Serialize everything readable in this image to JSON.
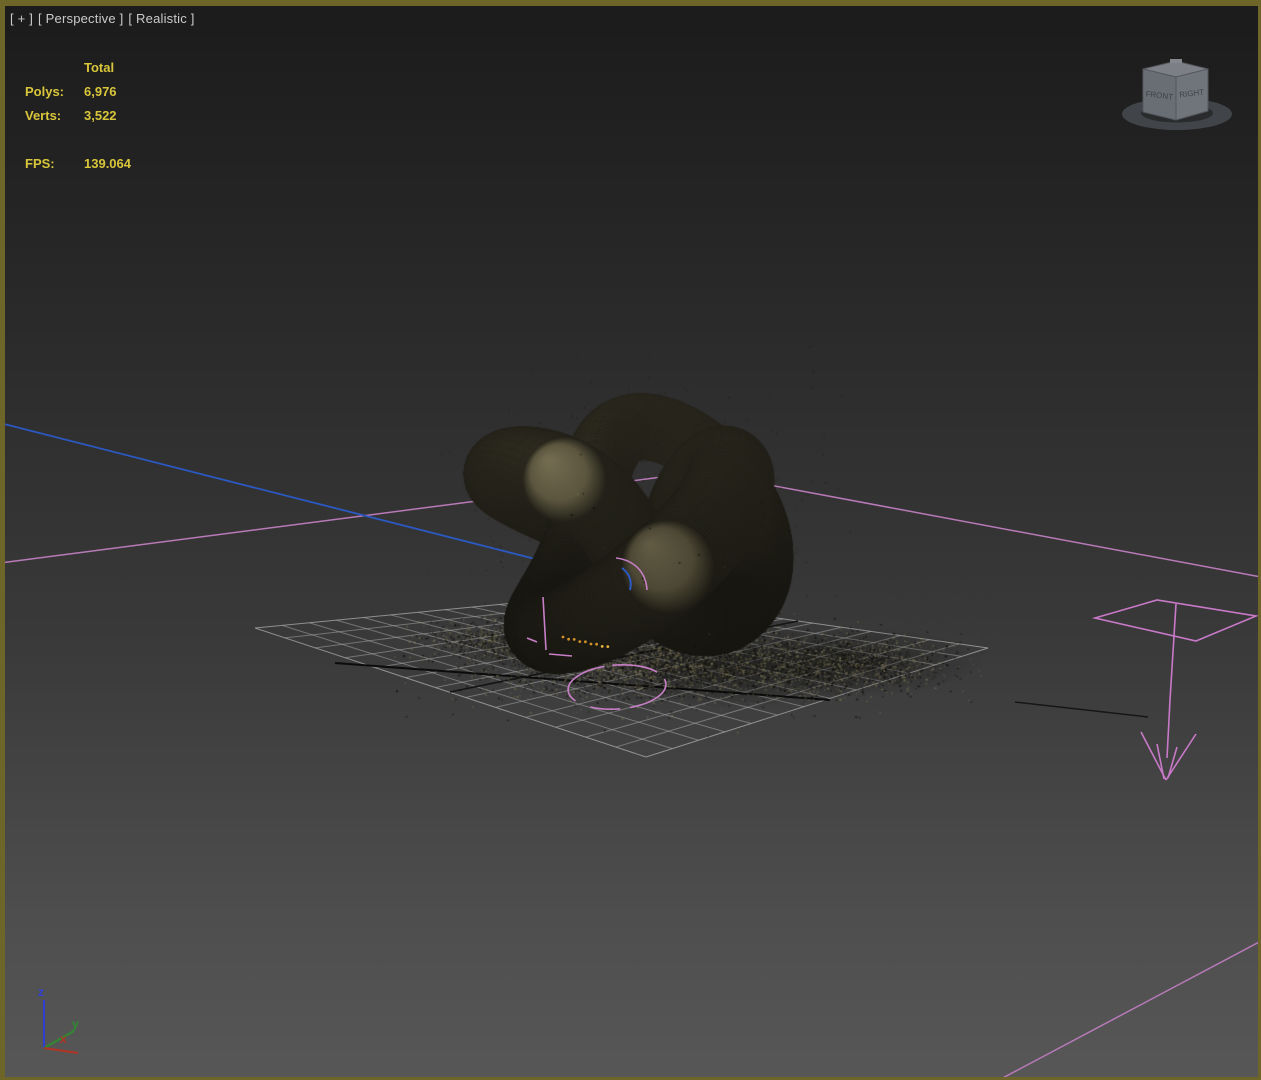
{
  "viewport": {
    "label": {
      "general_menu": "[ + ]",
      "pov": "[ Perspective ]",
      "shading": "[ Realistic ]"
    },
    "border_color": "#6e6529",
    "background_top": "#1b1b1b",
    "background_bottom": "#575757"
  },
  "statistics": {
    "header": "Total",
    "rows": [
      {
        "label": "Polys:",
        "value": "6,976"
      },
      {
        "label": "Verts:",
        "value": "3,522"
      }
    ],
    "fps": {
      "label": "FPS:",
      "value": "139.064"
    },
    "text_color": "#d9c63a"
  },
  "viewcube": {
    "left_face": "FRONT",
    "right_face": "RIGHT"
  },
  "axis_tripod": {
    "x": {
      "label": "x",
      "color": "#b23424"
    },
    "y": {
      "label": "y",
      "color": "#2e8b2e"
    },
    "z": {
      "label": "z",
      "color": "#2f3fd3"
    }
  },
  "scene": {
    "object": "torus-knot",
    "object_color": "#5f5942",
    "grid_color": "#a5a5a5",
    "gizmo_color": "#c87fc8",
    "spline_color": "#2b59c3",
    "particle_color": "#d19126"
  }
}
